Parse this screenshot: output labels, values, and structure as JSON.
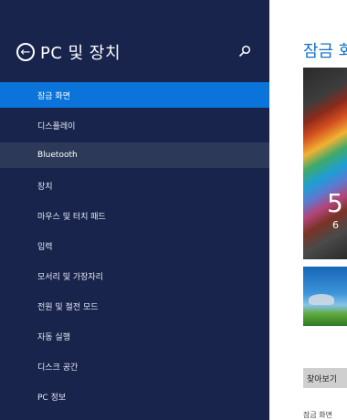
{
  "sidebar": {
    "title": "PC 및 장치",
    "items": [
      {
        "label": "잠금 화면"
      },
      {
        "label": "디스플레이"
      },
      {
        "label": "Bluetooth"
      },
      {
        "label": "장치"
      },
      {
        "label": "마우스 및 터치 패드"
      },
      {
        "label": "입력"
      },
      {
        "label": "모서리 및 가장자리"
      },
      {
        "label": "전원 및 절전 모드"
      },
      {
        "label": "자동 실행"
      },
      {
        "label": "디스크 공간"
      },
      {
        "label": "PC 정보"
      }
    ]
  },
  "content": {
    "title": "잠금 화면",
    "preview_time": "5",
    "preview_date": "6",
    "browse_label": "찾아보기",
    "footer_text": "잠금 화면"
  },
  "colors": {
    "sidebar_bg": "#18244c",
    "selected": "#0a74db",
    "hover": "#2c3959",
    "accent_text": "#0f72c8"
  }
}
